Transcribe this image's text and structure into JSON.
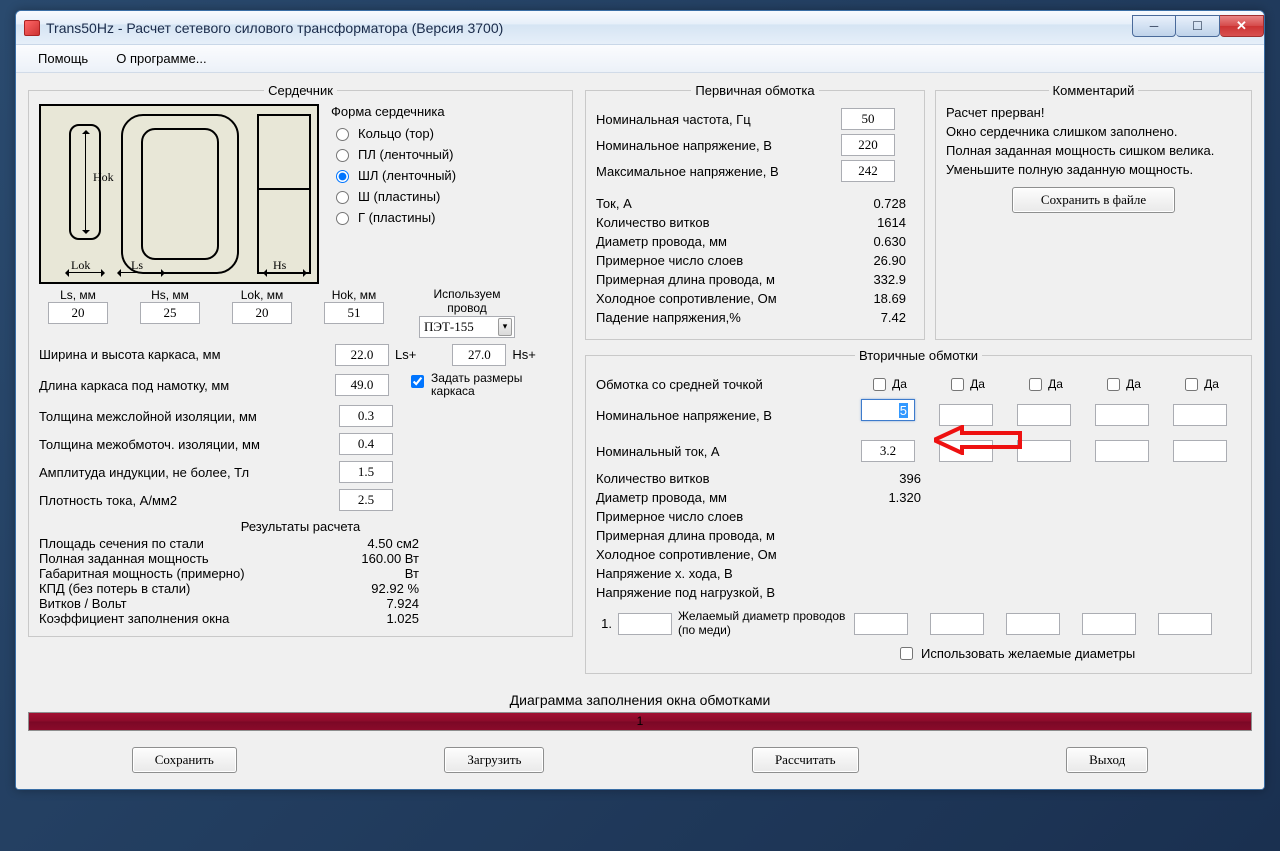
{
  "window": {
    "title": "Trans50Hz - Расчет сетевого силового трансформатора (Версия 3700)"
  },
  "menu": {
    "help": "Помощь",
    "about": "О программе..."
  },
  "core": {
    "legend": "Сердечник",
    "shape_label": "Форма сердечника",
    "shapes": {
      "ring": "Кольцо (тор)",
      "pl": "ПЛ (ленточный)",
      "shl": "ШЛ (ленточный)",
      "sh": "Ш  (пластины)",
      "g": "Г  (пластины)"
    },
    "dims": {
      "ls_label": "Ls, мм",
      "ls": "20",
      "hs_label": "Hs, мм",
      "hs": "25",
      "lok_label": "Lok, мм",
      "lok": "20",
      "hok_label": "Hok, мм",
      "hok": "51"
    },
    "wire_label1": "Используем",
    "wire_label2": "провод",
    "wire_value": "ПЭТ-155",
    "diagram": {
      "hok": "Hok",
      "lok": "Lok",
      "ls": "Ls",
      "hs": "Hs"
    },
    "frame": {
      "wh_label": "Ширина и высота каркаса, мм",
      "wh_ls": "22.0",
      "wh_ls_suffix": "Ls+",
      "wh_hs": "27.0",
      "wh_hs_suffix": "Hs+",
      "length_label": "Длина каркаса под намотку, мм",
      "length": "49.0",
      "use_frame_label": "Задать размеры каркаса",
      "interlayer_label": "Толщина межслойной изоляции, мм",
      "interlayer": "0.3",
      "interwinding_label": "Толщина межобмоточ. изоляции, мм",
      "interwinding": "0.4",
      "induction_label": "Амплитуда индукции, не более, Тл",
      "induction": "1.5",
      "density_label": "Плотность тока, А/мм2",
      "density": "2.5"
    },
    "results": {
      "header": "Результаты расчета",
      "rows": {
        "area": {
          "l": "Площадь сечения по стали",
          "v": "4.50 см2"
        },
        "fullpower": {
          "l": "Полная заданная мощность",
          "v": "160.00 Вт"
        },
        "gabpower": {
          "l": "Габаритная мощность (примерно)",
          "v": "Вт"
        },
        "eff": {
          "l": "КПД (без потерь в стали)",
          "v": "92.92 %"
        },
        "tpv": {
          "l": "Витков / Вольт",
          "v": "7.924"
        },
        "fill": {
          "l": "Коэффициент заполнения окна",
          "v": "1.025"
        }
      }
    }
  },
  "primary": {
    "legend": "Первичная обмотка",
    "freq_label": "Номинальная частота, Гц",
    "freq": "50",
    "vnom_label": "Номинальное напряжение, В",
    "vnom": "220",
    "vmax_label": "Максимальное напряжение, В",
    "vmax": "242",
    "rows": {
      "current": {
        "l": "Ток, А",
        "v": "0.728"
      },
      "turns": {
        "l": "Количество витков",
        "v": "1614"
      },
      "diam": {
        "l": "Диаметр провода, мм",
        "v": "0.630"
      },
      "layers": {
        "l": "Примерное число слоев",
        "v": "26.90"
      },
      "length": {
        "l": "Примерная длина провода, м",
        "v": "332.9"
      },
      "coldr": {
        "l": "Холодное сопротивление, Ом",
        "v": "18.69"
      },
      "drop": {
        "l": "Падение напряжения,%",
        "v": "7.42"
      }
    }
  },
  "comment": {
    "legend": "Комментарий",
    "text": "Расчет прерван!\nОкно сердечника слишком заполнено.\nПолная заданная мощность сишком велика.\nУменьшите полную заданную мощность.",
    "save_btn": "Сохранить в файле"
  },
  "secondary": {
    "legend": "Вторичные обмотки",
    "centertap_label": "Обмотка со средней точкой",
    "vnom_label": "Номинальное напряжение, В",
    "inom_label": "Номинальный ток, А",
    "da": "Да",
    "col1": {
      "v": "5",
      "i": "3.2"
    },
    "rows": {
      "turns": {
        "l": "Количество витков",
        "v": "396"
      },
      "diam": {
        "l": "Диаметр провода, мм",
        "v": "1.320"
      },
      "layers": {
        "l": "Примерное число слоев",
        "v": ""
      },
      "length": {
        "l": "Примерная длина провода, м",
        "v": ""
      },
      "coldr": {
        "l": "Холодное сопротивление, Ом",
        "v": ""
      },
      "vopen": {
        "l": "Напряжение х. хода, В",
        "v": ""
      },
      "vload": {
        "l": "Напряжение под нагрузкой, В",
        "v": ""
      }
    },
    "wish_num": "1.",
    "wish_label": "Желаемый диаметр проводов  (по меди)",
    "use_wish_label": "Использовать желаемые диаметры"
  },
  "diagram_label": "Диаграмма заполнения окна обмотками",
  "progress_text": "1",
  "buttons": {
    "save": "Сохранить",
    "load": "Загрузить",
    "calc": "Рассчитать",
    "exit": "Выход"
  }
}
